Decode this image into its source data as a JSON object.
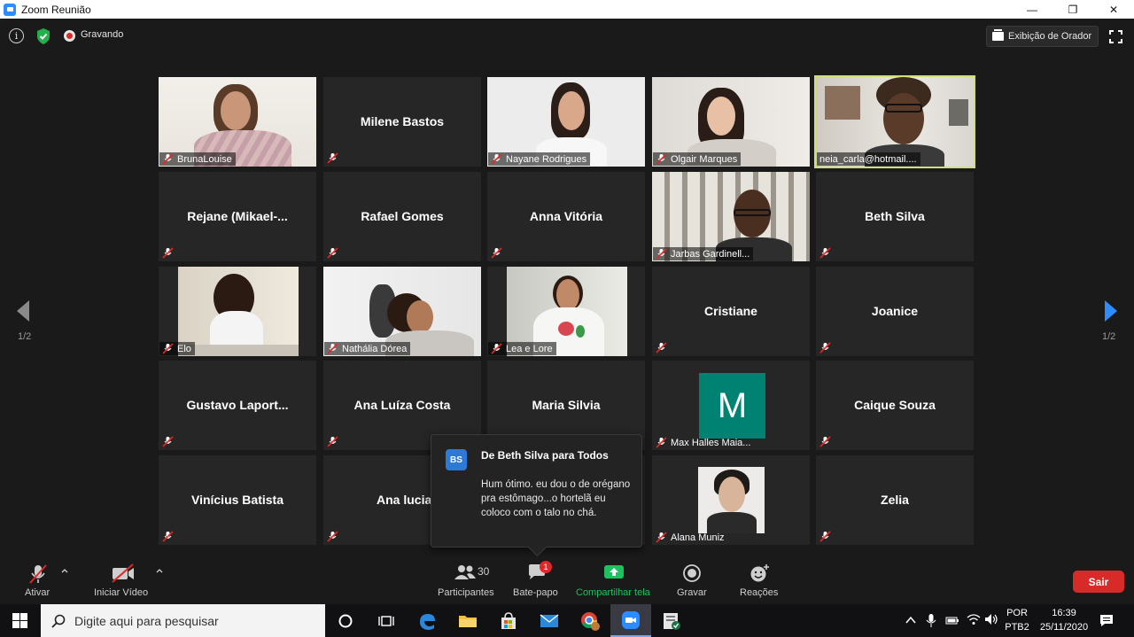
{
  "window": {
    "title": "Zoom Reunião",
    "controls": [
      "—",
      "❐",
      "✕"
    ]
  },
  "topbar": {
    "recording_label": "Gravando",
    "speaker_view_label": "Exibição de Orador"
  },
  "participants": [
    {
      "name": "BrunaLouise",
      "video": true
    },
    {
      "name": "Milene Bastos",
      "video": false
    },
    {
      "name": "Nayane Rodrigues",
      "video": true
    },
    {
      "name": "Olgair Marques",
      "video": true
    },
    {
      "name": "neia_carla@hotmail....",
      "video": true,
      "active_speaker": true
    },
    {
      "name": "Rejane  (Mikael-...",
      "video": false
    },
    {
      "name": "Rafael Gomes",
      "video": false
    },
    {
      "name": "Anna Vitória",
      "video": false
    },
    {
      "name": "Jarbas Gardinell...",
      "video": true
    },
    {
      "name": "Beth Silva",
      "video": false
    },
    {
      "name": "Elo",
      "video": true
    },
    {
      "name": "Nathália Dórea",
      "video": true
    },
    {
      "name": "Lea e Lore",
      "video": true
    },
    {
      "name": "Cristiane",
      "video": false
    },
    {
      "name": "Joanice",
      "video": false
    },
    {
      "name": "Gustavo  Laport...",
      "video": false
    },
    {
      "name": "Ana Luíza Costa",
      "video": false
    },
    {
      "name": "Maria Silvia",
      "video": false
    },
    {
      "name": "Max Halles Maia...",
      "video": false,
      "avatar_letter": "M"
    },
    {
      "name": "Caique Souza",
      "video": false
    },
    {
      "name": "Vinícius Batista",
      "video": false
    },
    {
      "name": "Ana lucia",
      "video": false
    },
    {
      "name": "",
      "video": false
    },
    {
      "name": "Alana Muniz",
      "video": true
    },
    {
      "name": "Zelia",
      "video": false
    }
  ],
  "pagination": {
    "left": "1/2",
    "right": "1/2"
  },
  "chat_popup": {
    "avatar": "BS",
    "from": "De Beth Silva para Todos",
    "message": "Hum ótimo. eu dou o de orégano pra estômago...o hortelã eu coloco com o talo no chá."
  },
  "toolbar": {
    "unmute_label": "Ativar",
    "video_label": "Iniciar Vídeo",
    "participants_label": "Participantes",
    "participants_count": "30",
    "chat_label": "Bate-papo",
    "chat_badge": "1",
    "share_label": "Compartilhar tela",
    "record_label": "Gravar",
    "reactions_label": "Reações",
    "leave_label": "Sair"
  },
  "taskbar": {
    "search_placeholder": "Digite aqui para pesquisar",
    "language": "POR",
    "keyboard": "PTB2",
    "time": "16:39",
    "date": "25/11/2020"
  },
  "colors": {
    "active_speaker_border": "#cfe07a",
    "share_green": "#1ec060",
    "leave_red": "#d92a2a",
    "avatar_teal": "#008272",
    "nav_arrow_blue": "#2d8cff"
  }
}
